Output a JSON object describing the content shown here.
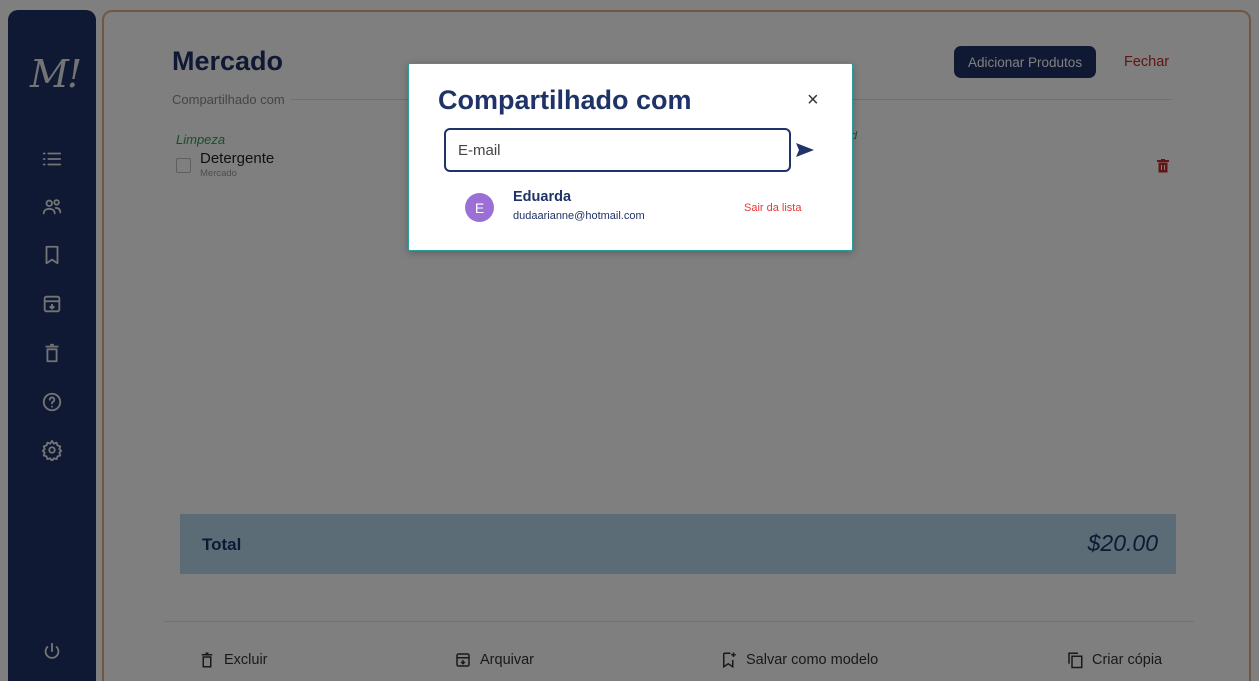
{
  "sidebar": {
    "logo": "M!",
    "items": [
      {
        "name": "list-icon"
      },
      {
        "name": "shared-users-icon"
      },
      {
        "name": "bookmark-icon"
      },
      {
        "name": "archive-icon"
      },
      {
        "name": "trash-icon"
      },
      {
        "name": "help-icon"
      },
      {
        "name": "settings-icon"
      }
    ],
    "bottom_icon": "power-icon"
  },
  "list": {
    "title": "Mercado",
    "shared_with_label": "Compartilhado com",
    "add_products_label": "Adicionar Produtos",
    "close_label": "Fechar",
    "category": "Limpeza",
    "category_right": "d",
    "items": [
      {
        "name": "Detergente",
        "list": "Mercado"
      }
    ],
    "total_label": "Total",
    "total_value": "$20.00"
  },
  "footer": {
    "delete_label": "Excluir",
    "archive_label": "Arquivar",
    "save_template_label": "Salvar como modelo",
    "copy_label": "Criar cópia"
  },
  "modal": {
    "title": "Compartilhado com",
    "close_glyph": "×",
    "email_placeholder": "E-mail",
    "members": [
      {
        "initial": "E",
        "name": "Eduarda",
        "email": "dudaarianne@hotmail.com",
        "leave_label": "Sair da lista"
      }
    ]
  },
  "colors": {
    "primary": "#1f3368",
    "accent_border": "#e2ae7e",
    "danger": "#e53935",
    "category_green": "#2e9e4a",
    "total_bar": "#b7d9ec",
    "avatar": "#9b6fd6",
    "modal_border": "#2a9d9d"
  }
}
